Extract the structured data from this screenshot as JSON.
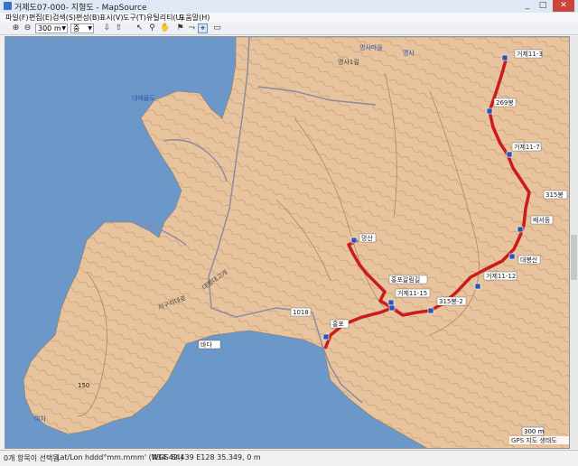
{
  "window": {
    "title": "거제도07-000- 지형도 - MapSource",
    "controls": [
      "minimize-icon",
      "maximize-icon",
      "close-icon"
    ]
  },
  "menu": [
    "파일(F)",
    "편집(E)",
    "검색(S)",
    "편성(B)",
    "표시(V)",
    "도구(T)",
    "유틸리티(U)",
    "도움말(H)"
  ],
  "toolbar": {
    "zoom_in_icon": "zoom-in-icon",
    "zoom_out_icon": "zoom-out-icon",
    "scale_value": "300 m",
    "detail_value": "중",
    "tools": [
      "device-receive-icon",
      "device-send-icon",
      "select-icon",
      "zoom-tool-icon",
      "pan-hand-icon",
      "waypoint-flag-icon",
      "route-icon",
      "track-select-icon",
      "measure-icon"
    ]
  },
  "map": {
    "colors": {
      "sea": "#6b98c8",
      "land": "#e7c39e",
      "contour": "#b98a62",
      "track": "#cc1b1b",
      "road": "#8a8a9c"
    },
    "labels": {
      "top_village": "명사1길",
      "village_sign": "명사마을",
      "label_269": "269봉",
      "label_peak_11_3": "거제11-3",
      "label_peak_11_7": "거제11-7",
      "label_315_east": "315봉",
      "label_seojaedeung": "배서등",
      "label_daebongsan": "대봉산",
      "label_11_12": "거제11-12",
      "label_315_south": "315봉-2",
      "label_11_15": "거제11-15",
      "label_manggwan": "망산",
      "label_hongpo": "홍포갈림길",
      "label_hongpo_south": "홍포",
      "label_road_1018": "1018",
      "label_pass": "대병대고개",
      "label_sea": "바다",
      "label_150": "150",
      "label_port": "여차",
      "label_west_road": "저구리대로",
      "label_small_1": "대매물도",
      "label_small_2": "명사",
      "scale_text": "300 m",
      "copyright": "GPS 지도 생태도"
    }
  },
  "status": {
    "selection": "0개 항목이 선택됨",
    "format": "Lat/Lon hddd°mm.mmm' (WGS 84)",
    "coords": "N34 42.439 E128 35.349, 0 m"
  }
}
